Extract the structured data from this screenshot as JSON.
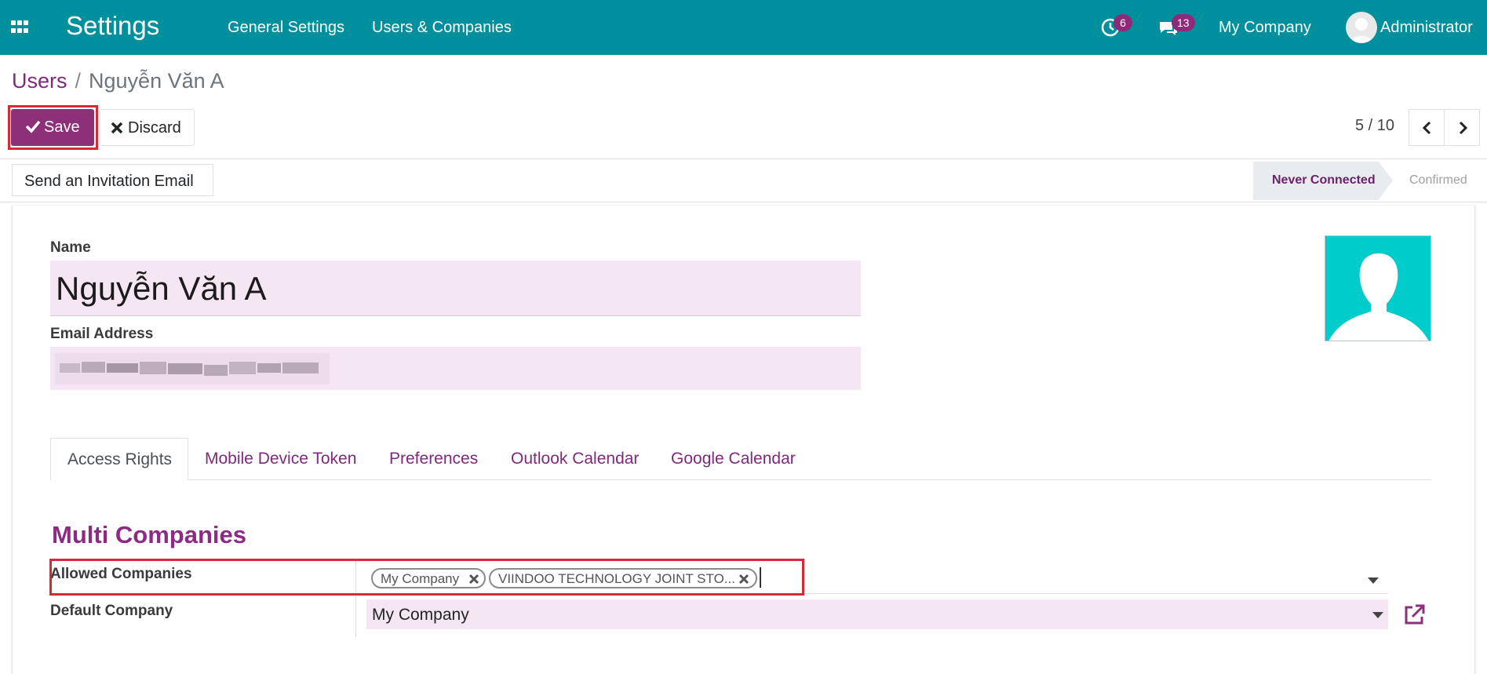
{
  "navbar": {
    "app_title": "Settings",
    "menu": [
      "General Settings",
      "Users & Companies"
    ],
    "activity_count": "6",
    "messages_count": "13",
    "company": "My Company",
    "user": "Administrator"
  },
  "breadcrumb": {
    "parent": "Users",
    "current": "Nguyễn Văn A"
  },
  "toolbar": {
    "save_label": "Save",
    "discard_label": "Discard",
    "pager": "5 / 10"
  },
  "statusbar": {
    "invite_label": "Send an Invitation Email",
    "states": [
      "Never Connected",
      "Confirmed"
    ],
    "active_state": "Never Connected"
  },
  "form": {
    "name_label": "Name",
    "name_value": "Nguyễn Văn A",
    "email_label": "Email Address",
    "tabs": [
      "Access Rights",
      "Mobile Device Token",
      "Preferences",
      "Outlook Calendar",
      "Google Calendar"
    ],
    "active_tab": "Access Rights",
    "section_title": "Multi Companies",
    "allowed_companies_label": "Allowed Companies",
    "allowed_companies": [
      "My Company",
      "VIINDOO TECHNOLOGY JOINT STO..."
    ],
    "default_company_label": "Default Company",
    "default_company_value": "My Company"
  },
  "colors": {
    "navbar": "#00909d",
    "primary": "#8e2f7a",
    "input_bg": "#f4e6f2",
    "highlight_outline": "#d62a36"
  }
}
